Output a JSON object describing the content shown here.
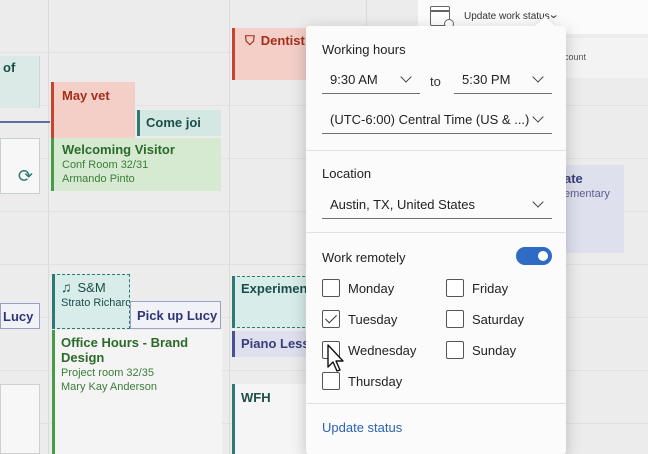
{
  "status_bar": {
    "label": "Update work status",
    "account_text": "count"
  },
  "calendar": {
    "events": {
      "dentist": "Dentist",
      "partial_left_top": "of",
      "may_vet": "May vet",
      "come_join": "Come joi",
      "welcoming": {
        "title": "Welcoming Visitor",
        "room": "Conf Room 32/31",
        "person": "Armando Pinto"
      },
      "right_partial": {
        "title": "ate",
        "subtitle": "ementary"
      },
      "pickup_partial": "Lucy",
      "sm": {
        "title": "S&M",
        "person": "Strato Richard"
      },
      "pickup": "Pick up Lucy",
      "office_hours": {
        "title": "Office Hours - Brand Design",
        "room": "Project room 32/35",
        "person": "Mary Kay Anderson"
      },
      "experiment": "Experiment",
      "piano": "Piano Lesso",
      "wfh": "WFH"
    }
  },
  "panel": {
    "working_hours": {
      "title": "Working hours",
      "start": "9:30 AM",
      "to_label": "to",
      "end": "5:30 PM",
      "timezone": "(UTC-6:00) Central Time (US & ...)"
    },
    "location": {
      "title": "Location",
      "value": "Austin, TX, United States"
    },
    "work_remotely": {
      "title": "Work remotely",
      "enabled": true,
      "days": [
        {
          "label": "Monday",
          "checked": false
        },
        {
          "label": "Tuesday",
          "checked": true
        },
        {
          "label": "Wednesday",
          "checked": false
        },
        {
          "label": "Thursday",
          "checked": false
        },
        {
          "label": "Friday",
          "checked": false
        },
        {
          "label": "Saturday",
          "checked": false
        },
        {
          "label": "Sunday",
          "checked": false
        }
      ]
    },
    "update_status": "Update status"
  }
}
